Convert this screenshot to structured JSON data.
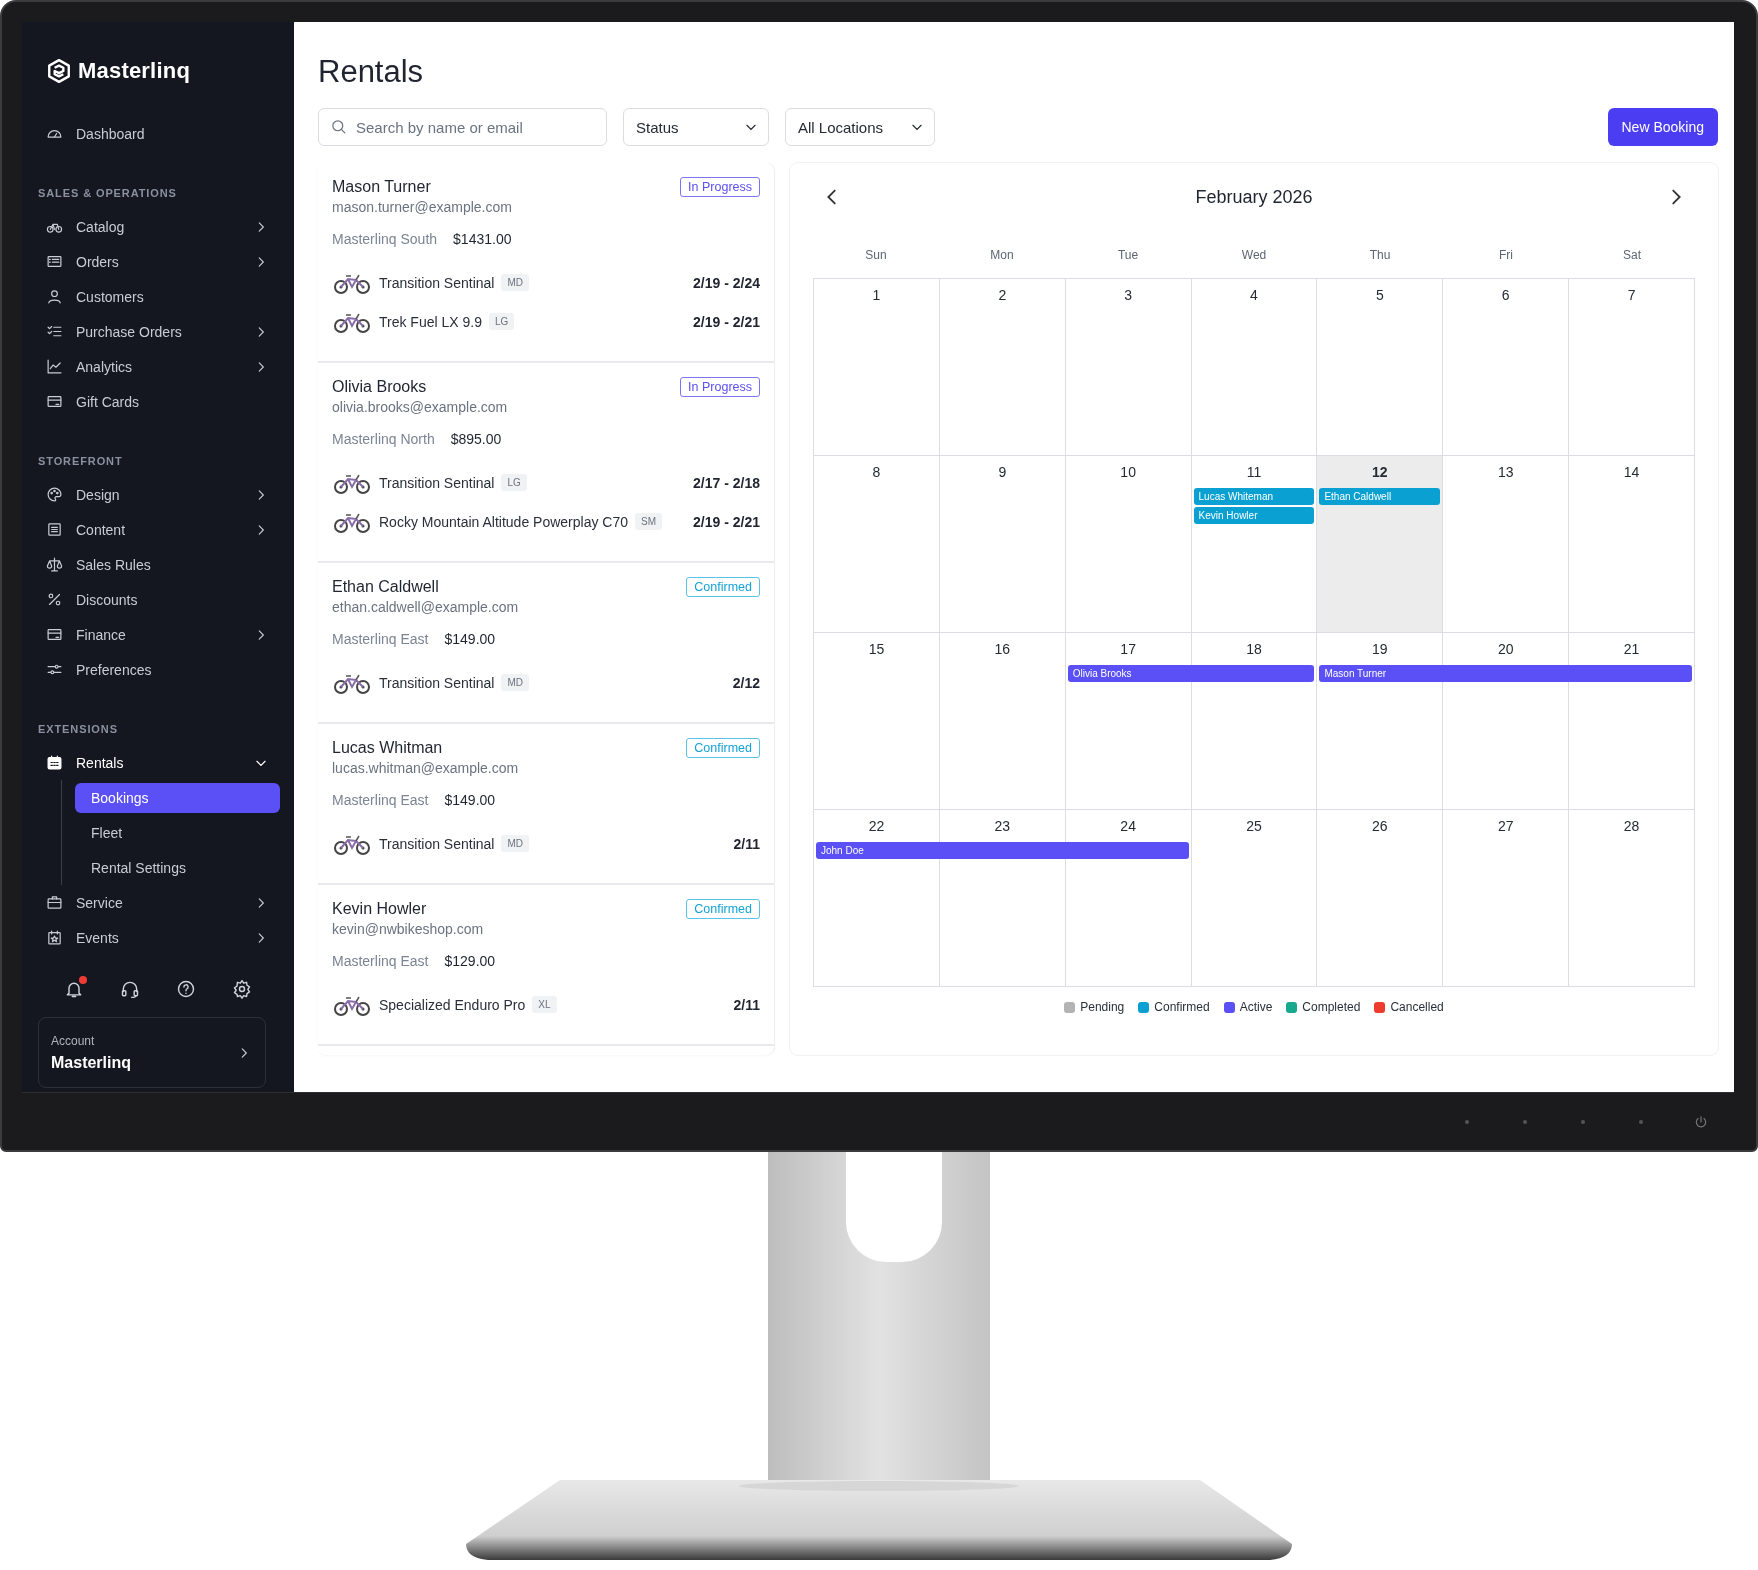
{
  "logo": "Masterlinq",
  "sidebar": {
    "sections": [
      {
        "items": [
          {
            "label": "Dashboard",
            "expandable": false,
            "expanded": false
          }
        ]
      },
      {
        "heading": "SALES & OPERATIONS",
        "items": [
          {
            "label": "Catalog",
            "expandable": true,
            "expanded": false
          },
          {
            "label": "Orders",
            "expandable": true,
            "expanded": false
          },
          {
            "label": "Customers",
            "expandable": false,
            "expanded": false
          },
          {
            "label": "Purchase Orders",
            "expandable": true,
            "expanded": false
          },
          {
            "label": "Analytics",
            "expandable": true,
            "expanded": false
          },
          {
            "label": "Gift Cards",
            "expandable": false,
            "expanded": false
          }
        ]
      },
      {
        "heading": "STOREFRONT",
        "items": [
          {
            "label": "Design",
            "expandable": true,
            "expanded": false
          },
          {
            "label": "Content",
            "expandable": true,
            "expanded": false
          },
          {
            "label": "Sales Rules",
            "expandable": false,
            "expanded": false
          },
          {
            "label": "Discounts",
            "expandable": false,
            "expanded": false
          },
          {
            "label": "Finance",
            "expandable": true,
            "expanded": false
          },
          {
            "label": "Preferences",
            "expandable": false,
            "expanded": false
          }
        ]
      },
      {
        "heading": "EXTENSIONS",
        "items": [
          {
            "label": "Rentals",
            "expandable": true,
            "expanded": true,
            "children": [
              {
                "label": "Bookings",
                "selected": true
              },
              {
                "label": "Fleet",
                "selected": false
              },
              {
                "label": "Rental Settings",
                "selected": false
              }
            ]
          },
          {
            "label": "Service",
            "expandable": true,
            "expanded": false
          },
          {
            "label": "Events",
            "expandable": true,
            "expanded": false
          }
        ]
      }
    ],
    "utility_buttons": [
      {
        "alert_dot": true
      },
      {
        "alert_dot": false
      },
      {
        "alert_dot": false
      },
      {
        "alert_dot": false
      }
    ],
    "account": {
      "label": "Account",
      "name": "Masterlinq"
    }
  },
  "page": {
    "title": "Rentals",
    "search": {
      "placeholder": "Search by name or email"
    },
    "filters": [
      {
        "value": "Status"
      },
      {
        "value": "All Locations"
      }
    ],
    "primary_button": "New Booking"
  },
  "bookings": [
    {
      "name": "Mason Turner",
      "email": "mason.turner@example.com",
      "location": "Masterlinq South",
      "total": "$1431.00",
      "status": {
        "label": "In Progress",
        "kind": "in_progress"
      },
      "items": [
        {
          "bike": "Transition Sentinal",
          "size": "MD",
          "dates": "2/19 - 2/24"
        },
        {
          "bike": "Trek Fuel LX 9.9",
          "size": "LG",
          "dates": "2/19 - 2/21"
        }
      ]
    },
    {
      "name": "Olivia Brooks",
      "email": "olivia.brooks@example.com",
      "location": "Masterlinq North",
      "total": "$895.00",
      "status": {
        "label": "In Progress",
        "kind": "in_progress"
      },
      "items": [
        {
          "bike": "Transition Sentinal",
          "size": "LG",
          "dates": "2/17 - 2/18"
        },
        {
          "bike": "Rocky Mountain Altitude Powerplay C70",
          "size": "SM",
          "dates": "2/19 - 2/21"
        }
      ]
    },
    {
      "name": "Ethan Caldwell",
      "email": "ethan.caldwell@example.com",
      "location": "Masterlinq East",
      "total": "$149.00",
      "status": {
        "label": "Confirmed",
        "kind": "confirmed"
      },
      "items": [
        {
          "bike": "Transition Sentinal",
          "size": "MD",
          "dates": "2/12"
        }
      ]
    },
    {
      "name": "Lucas Whitman",
      "email": "lucas.whitman@example.com",
      "location": "Masterlinq East",
      "total": "$149.00",
      "status": {
        "label": "Confirmed",
        "kind": "confirmed"
      },
      "items": [
        {
          "bike": "Transition Sentinal",
          "size": "MD",
          "dates": "2/11"
        }
      ]
    },
    {
      "name": "Kevin Howler",
      "email": "kevin@nwbikeshop.com",
      "location": "Masterlinq East",
      "total": "$129.00",
      "status": {
        "label": "Confirmed",
        "kind": "confirmed"
      },
      "items": [
        {
          "bike": "Specialized Enduro Pro",
          "size": "XL",
          "dates": "2/11"
        }
      ]
    }
  ],
  "calendar": {
    "month": "February 2026",
    "weekdays": [
      "Sun",
      "Mon",
      "Tue",
      "Wed",
      "Thu",
      "Fri",
      "Sat"
    ],
    "weeks": [
      {
        "days": [
          {
            "day": "1",
            "today": false
          },
          {
            "day": "2",
            "today": false
          },
          {
            "day": "3",
            "today": false
          },
          {
            "day": "4",
            "today": false
          },
          {
            "day": "5",
            "today": false
          },
          {
            "day": "6",
            "today": false
          },
          {
            "day": "7",
            "today": false
          }
        ]
      },
      {
        "days": [
          {
            "day": "8",
            "today": false
          },
          {
            "day": "9",
            "today": false
          },
          {
            "day": "10",
            "today": false
          },
          {
            "day": "11",
            "today": false,
            "events": [
              {
                "name": "Lucas Whiteman",
                "color": "#0ba0d2",
                "continues": false
              },
              {
                "name": "Kevin Howler",
                "color": "#0ba0d2",
                "continues": false
              }
            ]
          },
          {
            "day": "12",
            "today": true,
            "events": [
              {
                "name": "Ethan Caldwell",
                "color": "#0ba0d2",
                "continues": false
              }
            ]
          },
          {
            "day": "13",
            "today": false
          },
          {
            "day": "14",
            "today": false
          }
        ]
      },
      {
        "days": [
          {
            "day": "15",
            "today": false
          },
          {
            "day": "16",
            "today": false
          },
          {
            "day": "17",
            "today": false,
            "events": [
              {
                "name": "Olivia Brooks",
                "color": "#5a50f6",
                "continues": false
              }
            ]
          },
          {
            "day": "18",
            "today": false,
            "events": [
              {
                "color": "#5a50f6",
                "continues": true
              }
            ]
          },
          {
            "day": "19",
            "today": false,
            "events": [
              {
                "name": "Mason Turner",
                "color": "#5a50f6",
                "continues": false
              }
            ]
          },
          {
            "day": "20",
            "today": false,
            "events": [
              {
                "color": "#5a50f6",
                "continues": true
              }
            ]
          },
          {
            "day": "21",
            "today": false,
            "events": [
              {
                "color": "#5a50f6",
                "continues": true
              }
            ]
          }
        ]
      },
      {
        "days": [
          {
            "day": "22",
            "today": false,
            "events": [
              {
                "name": "John Doe",
                "color": "#5a50f6",
                "continues": false
              }
            ]
          },
          {
            "day": "23",
            "today": false,
            "events": [
              {
                "color": "#5a50f6",
                "continues": true
              }
            ]
          },
          {
            "day": "24",
            "today": false,
            "events": [
              {
                "color": "#5a50f6",
                "continues": true
              }
            ]
          },
          {
            "day": "25",
            "today": false
          },
          {
            "day": "26",
            "today": false
          },
          {
            "day": "27",
            "today": false
          },
          {
            "day": "28",
            "today": false
          }
        ]
      }
    ],
    "legend": [
      {
        "label": "Pending",
        "color": "#b3b3b3"
      },
      {
        "label": "Confirmed",
        "color": "#0ba0d2"
      },
      {
        "label": "Active",
        "color": "#5a50f6"
      },
      {
        "label": "Completed",
        "color": "#17a88e"
      },
      {
        "label": "Cancelled",
        "color": "#ee3b2f"
      }
    ]
  }
}
